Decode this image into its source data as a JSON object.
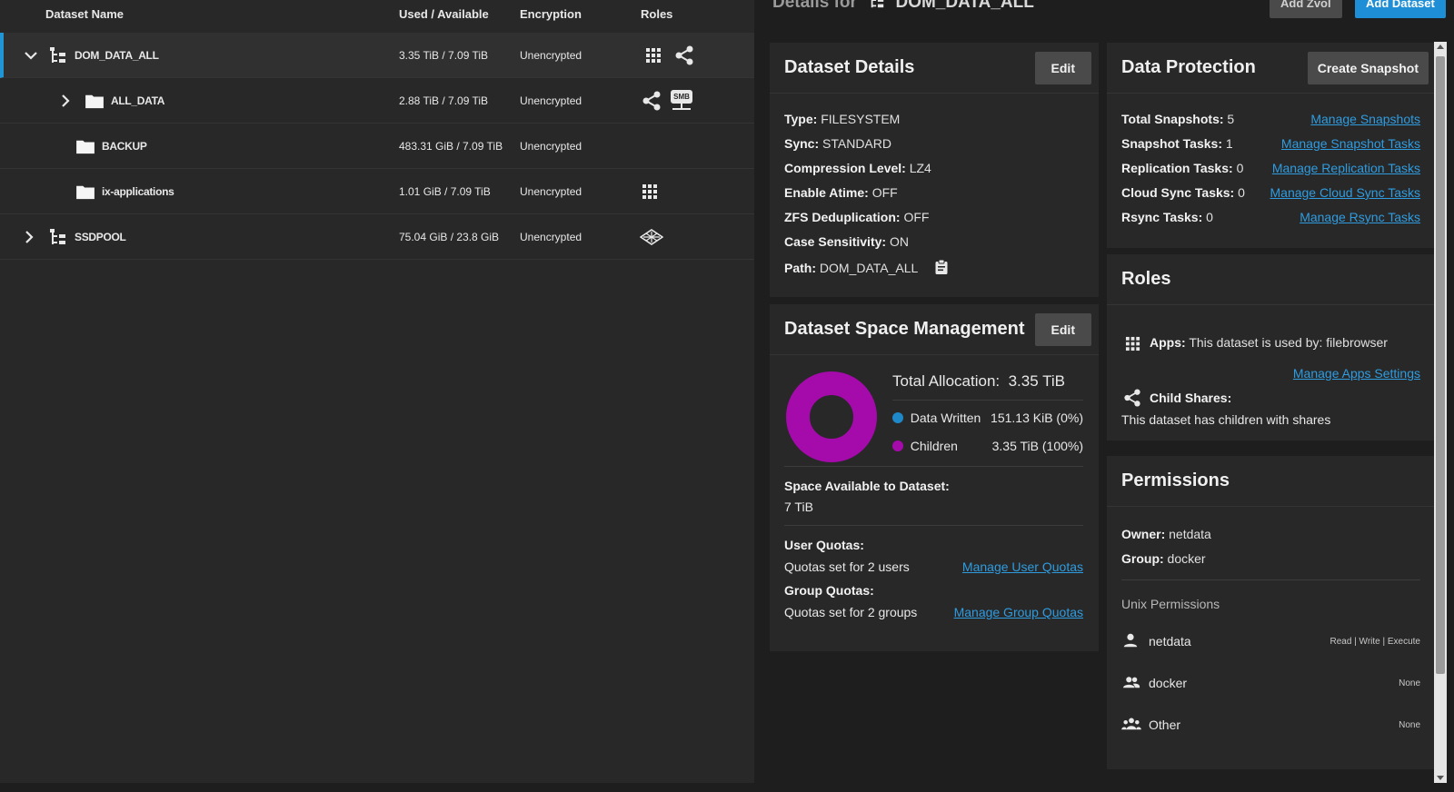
{
  "tree": {
    "headers": {
      "name": "Dataset Name",
      "used": "Used / Available",
      "encryption": "Encryption",
      "roles": "Roles"
    },
    "rows": [
      {
        "name": "DOM_DATA_ALL",
        "used": "3.35 TiB / 7.09 TiB",
        "encryption": "Unencrypted"
      },
      {
        "name": "ALL_DATA",
        "used": "2.88 TiB / 7.09 TiB",
        "encryption": "Unencrypted",
        "smb": "SMB"
      },
      {
        "name": "BACKUP",
        "used": "483.31 GiB / 7.09 TiB",
        "encryption": "Unencrypted"
      },
      {
        "name": "ix-applications",
        "used": "1.01 GiB / 7.09 TiB",
        "encryption": "Unencrypted"
      },
      {
        "name": "SSDPOOL",
        "used": "75.04 GiB / 23.8 GiB",
        "encryption": "Unencrypted"
      }
    ]
  },
  "header": {
    "prefix": "Details for",
    "dataset": "DOM_DATA_ALL",
    "add_zvol": "Add Zvol",
    "add_dataset": "Add Dataset"
  },
  "details": {
    "title": "Dataset Details",
    "edit": "Edit",
    "items": [
      {
        "label": "Type:",
        "value": "FILESYSTEM"
      },
      {
        "label": "Sync:",
        "value": "STANDARD"
      },
      {
        "label": "Compression Level:",
        "value": "LZ4"
      },
      {
        "label": "Enable Atime:",
        "value": "OFF"
      },
      {
        "label": "ZFS Deduplication:",
        "value": "OFF"
      },
      {
        "label": "Case Sensitivity:",
        "value": "ON"
      },
      {
        "label": "Path:",
        "value": "DOM_DATA_ALL"
      }
    ]
  },
  "space": {
    "title": "Dataset Space Management",
    "edit": "Edit",
    "total_label": "Total Allocation:",
    "total_value": "3.35 TiB",
    "legend": [
      {
        "label": "Data Written",
        "value": "151.13 KiB (0%)",
        "color": "#1e88c8"
      },
      {
        "label": "Children",
        "value": "3.35 TiB (100%)",
        "color": "#a50aab"
      }
    ],
    "donut_fraction_children": 1.0,
    "available_label": "Space Available to Dataset:",
    "available_value": "7 TiB",
    "user_quotas_label": "User Quotas:",
    "user_quotas_value": "Quotas set for 2 users",
    "user_quotas_link": "Manage User Quotas",
    "group_quotas_label": "Group Quotas:",
    "group_quotas_value": "Quotas set for 2 groups",
    "group_quotas_link": "Manage Group Quotas"
  },
  "protection": {
    "title": "Data Protection",
    "button": "Create Snapshot",
    "items": [
      {
        "label": "Total Snapshots:",
        "value": "5",
        "link": "Manage Snapshots"
      },
      {
        "label": "Snapshot Tasks:",
        "value": "1",
        "link": "Manage Snapshot Tasks"
      },
      {
        "label": "Replication Tasks:",
        "value": "0",
        "link": "Manage Replication Tasks"
      },
      {
        "label": "Cloud Sync Tasks:",
        "value": "0",
        "link": "Manage Cloud Sync Tasks"
      },
      {
        "label": "Rsync Tasks:",
        "value": "0",
        "link": "Manage Rsync Tasks"
      }
    ]
  },
  "roles": {
    "title": "Roles",
    "apps_label": "Apps:",
    "apps_value": "This dataset is used by: filebrowser",
    "apps_link": "Manage Apps Settings",
    "child_label": "Child Shares:",
    "child_value": "This dataset has children with shares"
  },
  "permissions": {
    "title": "Permissions",
    "owner_label": "Owner:",
    "owner_value": "netdata",
    "group_label": "Group:",
    "group_value": "docker",
    "unix_label": "Unix Permissions",
    "entries": [
      {
        "name": "netdata",
        "perm": "Read | Write | Execute"
      },
      {
        "name": "docker",
        "perm": "None"
      },
      {
        "name": "Other",
        "perm": "None"
      }
    ]
  },
  "colors": {
    "accent": "#2196d6",
    "link": "#2f9ce0",
    "children": "#a50aab",
    "data_written": "#1e88c8"
  }
}
